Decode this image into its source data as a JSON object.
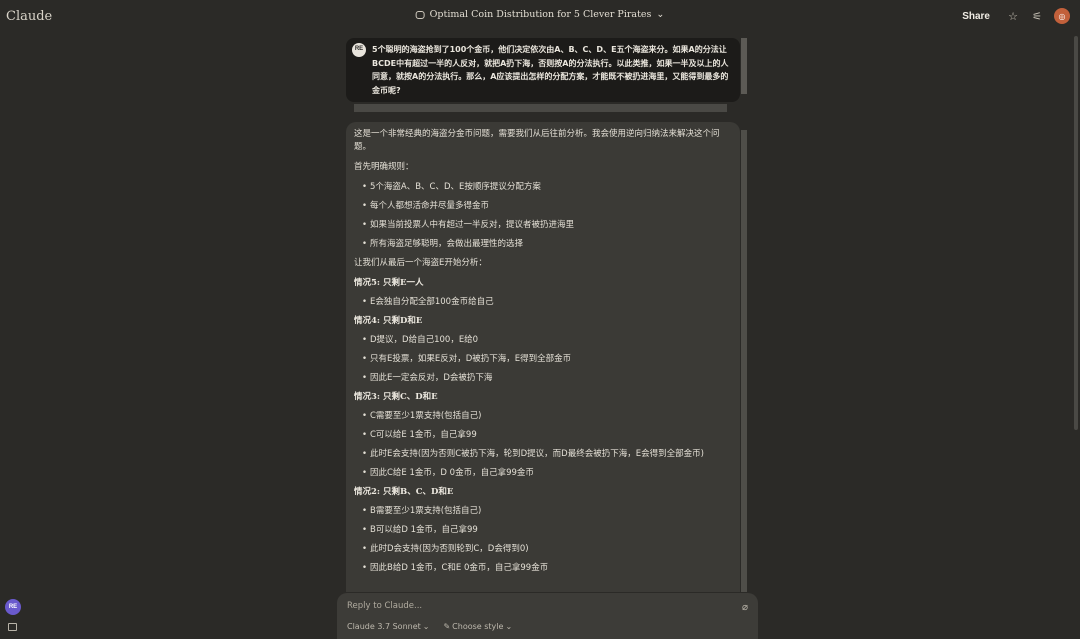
{
  "app": {
    "brand": "Claude"
  },
  "header": {
    "title": "Optimal Coin Distribution for 5 Clever Pirates",
    "share_label": "Share"
  },
  "user": {
    "initials": "RE",
    "message": "5个聪明的海盗抢到了100个金币，他们决定依次由A、B、C、D、E五个海盗来分。如果A的分法让BCDE中有超过一半的人反对，就把A扔下海，否则按A的分法执行。以此类推，如果一半及以上的人同意，就按A的分法执行。那么，A应该提出怎样的分配方案，才能既不被扔进海里，又能得到最多的金币呢?"
  },
  "assistant": {
    "intro": "这是一个非常经典的海盗分金币问题，需要我们从后往前分析。我会使用逆向归纳法来解决这个问题。",
    "rules_heading": "首先明确规则：",
    "rules": [
      "5个海盗A、B、C、D、E按顺序提议分配方案",
      "每个人都想活命并尽量多得金币",
      "如果当前投票人中有超过一半反对，提议者被扔进海里",
      "所有海盗足够聪明，会做出最理性的选择"
    ],
    "start": "让我们从最后一个海盗E开始分析：",
    "cases": [
      {
        "title": "情况5: 只剩E一人",
        "items": [
          "E会独自分配全部100金币给自己"
        ]
      },
      {
        "title": "情况4: 只剩D和E",
        "items": [
          "D提议，D给自己100，E给0",
          "只有E投票，如果E反对，D被扔下海，E得到全部金币",
          "因此E一定会反对，D会被扔下海"
        ]
      },
      {
        "title": "情况3: 只剩C、D和E",
        "items": [
          "C需要至少1票支持(包括自己)",
          "C可以给E 1金币，自己拿99",
          "此时E会支持(因为否则C被扔下海，轮到D提议，而D最终会被扔下海，E会得到全部金币)",
          "因此C给E 1金币，D 0金币，自己拿99金币"
        ]
      },
      {
        "title": "情况2: 只剩B、C、D和E",
        "items": [
          "B需要至少1票支持(包括自己)",
          "B可以给D 1金币，自己拿99",
          "此时D会支持(因为否则轮到C，D会得到0)",
          "因此B给D 1金币，C和E 0金币，自己拿99金币"
        ]
      }
    ]
  },
  "reply": {
    "placeholder": "Reply to Claude...",
    "model": "Claude 3.7 Sonnet",
    "style": "Choose style"
  }
}
